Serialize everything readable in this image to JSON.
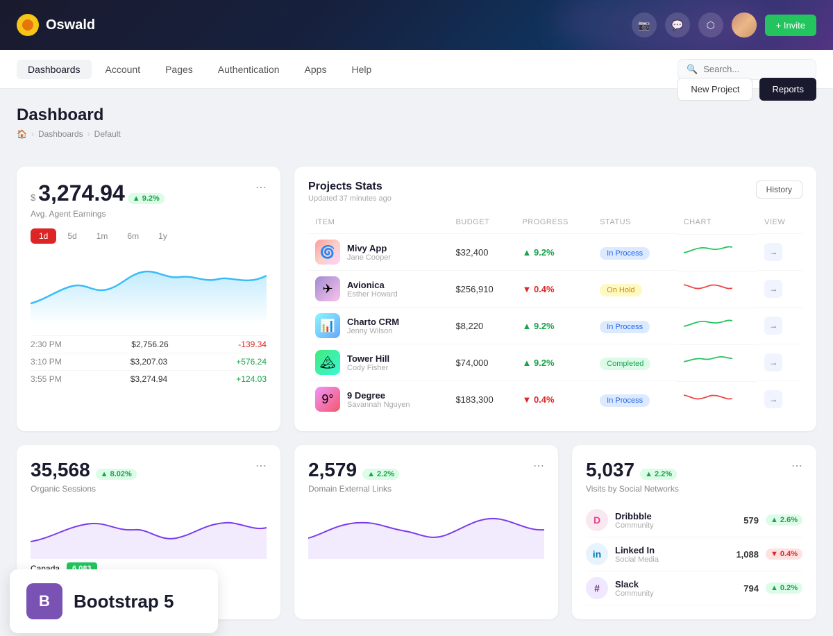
{
  "topnav": {
    "logo_text": "Oswald",
    "invite_label": "+ Invite"
  },
  "secondnav": {
    "tabs": [
      {
        "id": "dashboards",
        "label": "Dashboards",
        "active": true
      },
      {
        "id": "account",
        "label": "Account",
        "active": false
      },
      {
        "id": "pages",
        "label": "Pages",
        "active": false
      },
      {
        "id": "authentication",
        "label": "Authentication",
        "active": false
      },
      {
        "id": "apps",
        "label": "Apps",
        "active": false
      },
      {
        "id": "help",
        "label": "Help",
        "active": false
      }
    ],
    "search_placeholder": "Search..."
  },
  "page": {
    "title": "Dashboard",
    "breadcrumb": [
      "🏠",
      "Dashboards",
      "Default"
    ],
    "actions": {
      "new_project": "New Project",
      "reports": "Reports"
    }
  },
  "earnings": {
    "currency": "$",
    "amount": "3,274.94",
    "badge": "▲ 9.2%",
    "subtitle": "Avg. Agent Earnings",
    "time_filters": [
      "1d",
      "5d",
      "1m",
      "6m",
      "1y"
    ],
    "active_filter": "1d",
    "rows": [
      {
        "time": "2:30 PM",
        "value": "$2,756.26",
        "change": "-139.34",
        "positive": false
      },
      {
        "time": "3:10 PM",
        "value": "$3,207.03",
        "change": "+576.24",
        "positive": true
      },
      {
        "time": "3:55 PM",
        "value": "$3,274.94",
        "change": "+124.03",
        "positive": true
      }
    ]
  },
  "projects": {
    "title": "Projects Stats",
    "updated": "Updated 37 minutes ago",
    "history_btn": "History",
    "columns": [
      "ITEM",
      "BUDGET",
      "PROGRESS",
      "STATUS",
      "CHART",
      "VIEW"
    ],
    "items": [
      {
        "name": "Mivy App",
        "person": "Jane Cooper",
        "budget": "$32,400",
        "progress": "▲ 9.2%",
        "progress_up": true,
        "status": "In Process",
        "status_type": "inprocess",
        "icon_class": "icon-mivy"
      },
      {
        "name": "Avionica",
        "person": "Esther Howard",
        "budget": "$256,910",
        "progress": "▼ 0.4%",
        "progress_up": false,
        "status": "On Hold",
        "status_type": "onhold",
        "icon_class": "icon-avionica"
      },
      {
        "name": "Charto CRM",
        "person": "Jenny Wilson",
        "budget": "$8,220",
        "progress": "▲ 9.2%",
        "progress_up": true,
        "status": "In Process",
        "status_type": "inprocess",
        "icon_class": "icon-charto"
      },
      {
        "name": "Tower Hill",
        "person": "Cody Fisher",
        "budget": "$74,000",
        "progress": "▲ 9.2%",
        "progress_up": true,
        "status": "Completed",
        "status_type": "completed",
        "icon_class": "icon-tower"
      },
      {
        "name": "9 Degree",
        "person": "Savannah Nguyen",
        "budget": "$183,300",
        "progress": "▼ 0.4%",
        "progress_up": false,
        "status": "In Process",
        "status_type": "inprocess",
        "icon_class": "icon-9degree"
      }
    ]
  },
  "organic": {
    "value": "35,568",
    "badge": "▲ 8.02%",
    "label": "Organic Sessions"
  },
  "domain": {
    "value": "2,579",
    "badge": "▲ 2.2%",
    "label": "Domain External Links"
  },
  "social": {
    "value": "5,037",
    "badge": "▲ 2.2%",
    "label": "Visits by Social Networks",
    "items": [
      {
        "name": "Dribbble",
        "type": "Community",
        "count": "579",
        "badge": "▲ 2.6%",
        "positive": true,
        "icon": "D",
        "icon_class": "social-icon-dribbble"
      },
      {
        "name": "Linked In",
        "type": "Social Media",
        "count": "1,088",
        "badge": "▼ 0.4%",
        "positive": false,
        "icon": "in",
        "icon_class": "social-icon-linkedin"
      },
      {
        "name": "Slack",
        "type": "Community",
        "count": "794",
        "badge": "▲ 0.2%",
        "positive": true,
        "icon": "#",
        "icon_class": "social-icon-slack"
      }
    ]
  },
  "country": {
    "name": "Canada",
    "value": "6,083"
  },
  "bootstrap": {
    "icon": "B",
    "label": "Bootstrap 5"
  }
}
